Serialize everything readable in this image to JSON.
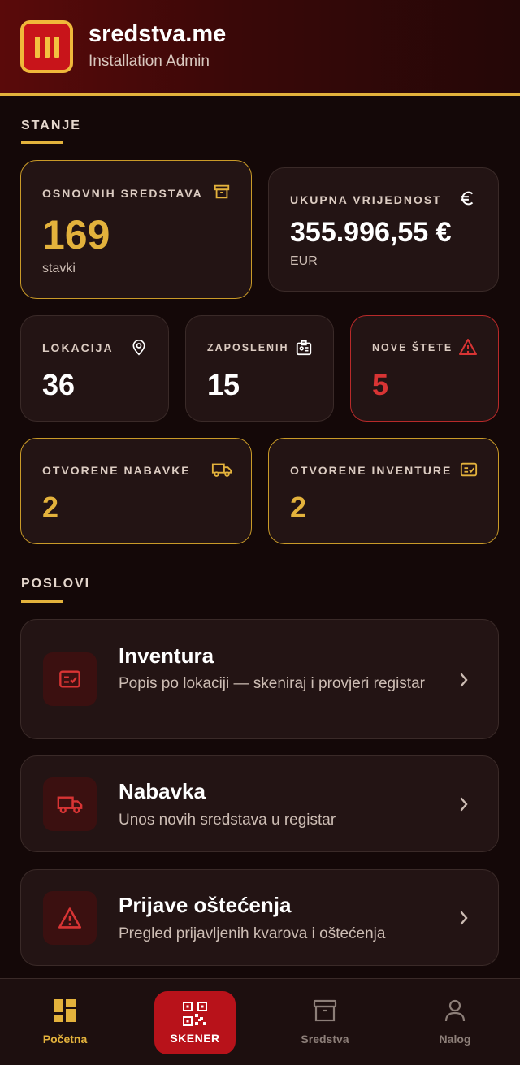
{
  "header": {
    "title": "sredstva.me",
    "subtitle": "Installation Admin"
  },
  "sections": {
    "stanje": "STANJE",
    "poslovi": "POSLOVI"
  },
  "stats": {
    "assets": {
      "label": "OSNOVNIH SREDSTAVA",
      "value": "169",
      "unit": "stavki"
    },
    "total_value": {
      "label": "UKUPNA VRIJEDNOST",
      "value": "355.996,55 €",
      "unit": "EUR"
    },
    "locations": {
      "label": "LOKACIJA",
      "value": "36"
    },
    "employees": {
      "label": "ZAPOSLENIH",
      "value": "15"
    },
    "damages": {
      "label": "NOVE ŠTETE",
      "value": "5"
    },
    "procurements": {
      "label": "OTVORENE NABAVKE",
      "value": "2"
    },
    "inventories": {
      "label": "OTVORENE INVENTURE",
      "value": "2"
    }
  },
  "jobs": [
    {
      "title": "Inventura",
      "desc": "Popis po lokaciji — skeniraj i provjeri registar",
      "icon": "checklist-icon"
    },
    {
      "title": "Nabavka",
      "desc": "Unos novih sredstava u registar",
      "icon": "truck-icon"
    },
    {
      "title": "Prijave oštećenja",
      "desc": "Pregled prijavljenih kvarova i oštećenja",
      "icon": "warning-icon"
    }
  ],
  "nav": {
    "home": "Početna",
    "scanner": "SKENER",
    "assets": "Sredstva",
    "account": "Nalog"
  },
  "colors": {
    "accent": "#e3b23c",
    "danger": "#d83434",
    "brand_red": "#b8121a",
    "background": "#140808"
  }
}
